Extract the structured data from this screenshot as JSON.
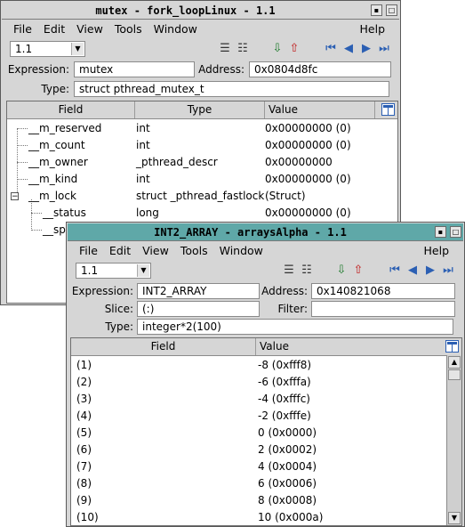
{
  "win1": {
    "title": "mutex - fork_loopLinux - 1.1",
    "menu": [
      "File",
      "Edit",
      "View",
      "Tools",
      "Window",
      "Help"
    ],
    "thread_value": "1.1",
    "expression_label": "Expression:",
    "expression_value": "mutex",
    "address_label": "Address:",
    "address_value": "0x0804d8fc",
    "type_label": "Type:",
    "type_value": "struct pthread_mutex_t",
    "columns": [
      "Field",
      "Type",
      "Value"
    ],
    "rows": [
      {
        "field": "__m_reserved",
        "type": "int",
        "value": "0x00000000 (0)"
      },
      {
        "field": "__m_count",
        "type": "int",
        "value": "0x00000000 (0)"
      },
      {
        "field": "__m_owner",
        "type": "_pthread_descr",
        "value": "0x00000000"
      },
      {
        "field": "__m_kind",
        "type": "int",
        "value": "0x00000000 (0)"
      },
      {
        "field": "__m_lock",
        "type": "struct _pthread_fastlock",
        "value": "(Struct)"
      },
      {
        "field": "__status",
        "type": "long",
        "value": "0x00000000 (0)"
      },
      {
        "field": "__sp",
        "type": "",
        "value": ""
      }
    ]
  },
  "win2": {
    "title": "INT2_ARRAY - arraysAlpha - 1.1",
    "menu": [
      "File",
      "Edit",
      "View",
      "Tools",
      "Window",
      "Help"
    ],
    "thread_value": "1.1",
    "expression_label": "Expression:",
    "expression_value": "INT2_ARRAY",
    "address_label": "Address:",
    "address_value": "0x140821068",
    "slice_label": "Slice:",
    "slice_value": "(:)",
    "filter_label": "Filter:",
    "filter_value": "",
    "type_label": "Type:",
    "type_value": "integer*2(100)",
    "columns": [
      "Field",
      "Value"
    ],
    "rows": [
      {
        "field": "(1)",
        "value": "-8 (0xfff8)"
      },
      {
        "field": "(2)",
        "value": "-6 (0xfffa)"
      },
      {
        "field": "(3)",
        "value": "-4 (0xfffc)"
      },
      {
        "field": "(4)",
        "value": "-2 (0xfffe)"
      },
      {
        "field": "(5)",
        "value": "0 (0x0000)"
      },
      {
        "field": "(6)",
        "value": "2 (0x0002)"
      },
      {
        "field": "(7)",
        "value": "4 (0x0004)"
      },
      {
        "field": "(8)",
        "value": "6 (0x0006)"
      },
      {
        "field": "(9)",
        "value": "8 (0x0008)"
      },
      {
        "field": "(10)",
        "value": "10 (0x000a)"
      }
    ]
  },
  "icons": [
    "list-icon",
    "list-alt-icon",
    "dive-down-icon",
    "dive-up-icon",
    "first-icon",
    "prev-icon",
    "next-icon",
    "last-icon",
    "column-config-icon"
  ],
  "colors": {
    "titlebar_active": "#5fa8a8",
    "window_bg": "#d6d6d6",
    "accent": "#2b5fb3"
  }
}
